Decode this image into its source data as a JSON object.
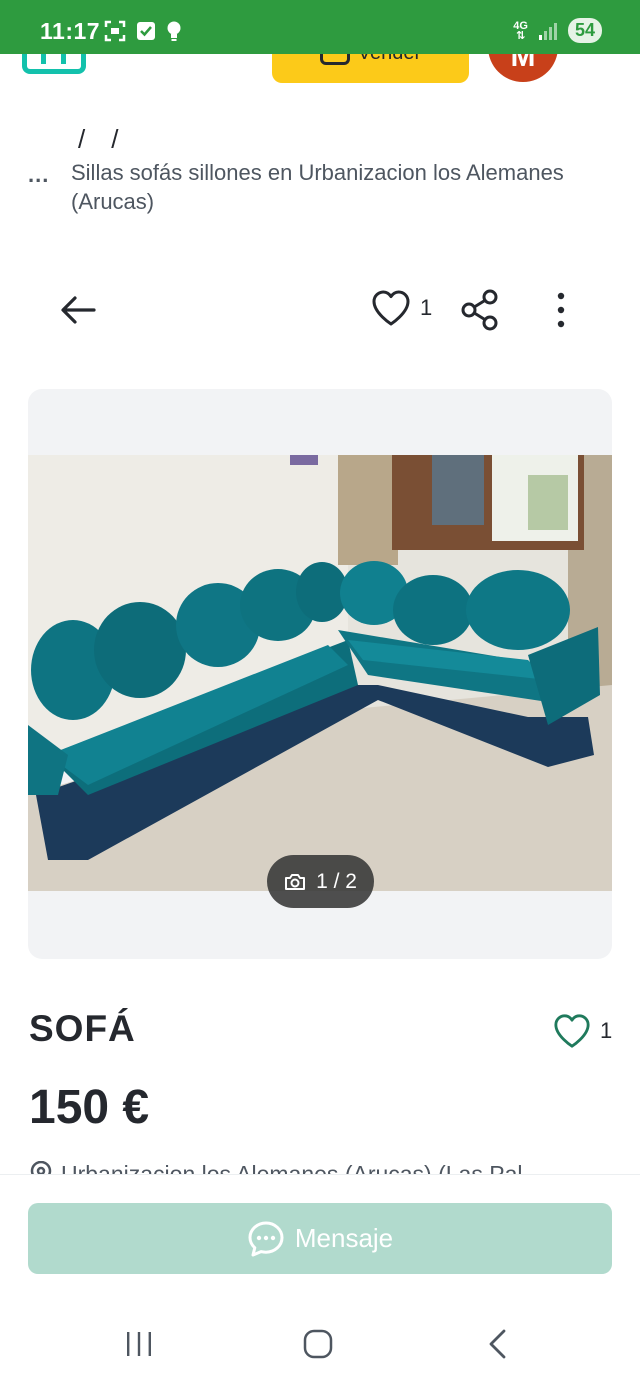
{
  "status_bar": {
    "time": "11:17",
    "network": "4G",
    "battery": "54"
  },
  "header": {
    "sell_label": "Vender",
    "avatar_initial": "M"
  },
  "breadcrumb": {
    "ellipsis": "...",
    "separators": [
      "/",
      "/"
    ],
    "current": "Sillas sofás sillones en Urbanizacion los Alemanes (Arucas)"
  },
  "actions": {
    "favorites_count": "1"
  },
  "gallery": {
    "counter": "1 / 2"
  },
  "product": {
    "title": "SOFÁ",
    "favorites_count": "1",
    "price": "150 €",
    "location": "Urbanizacion los Alemanes (Arucas) (Las Pal"
  },
  "bottom_bar": {
    "message_label": "Mensaje"
  },
  "colors": {
    "status_bar": "#2e9b3f",
    "brand_teal": "#13c1ac",
    "sell_yellow": "#fcca19",
    "avatar_red": "#c8401a",
    "message_button": "#b1dacd",
    "favorite_outline": "#1f7a5c"
  },
  "icons": [
    "back-arrow-icon",
    "heart-icon",
    "share-icon",
    "more-vertical-icon",
    "camera-icon",
    "location-pin-icon",
    "chat-bubble-icon"
  ]
}
